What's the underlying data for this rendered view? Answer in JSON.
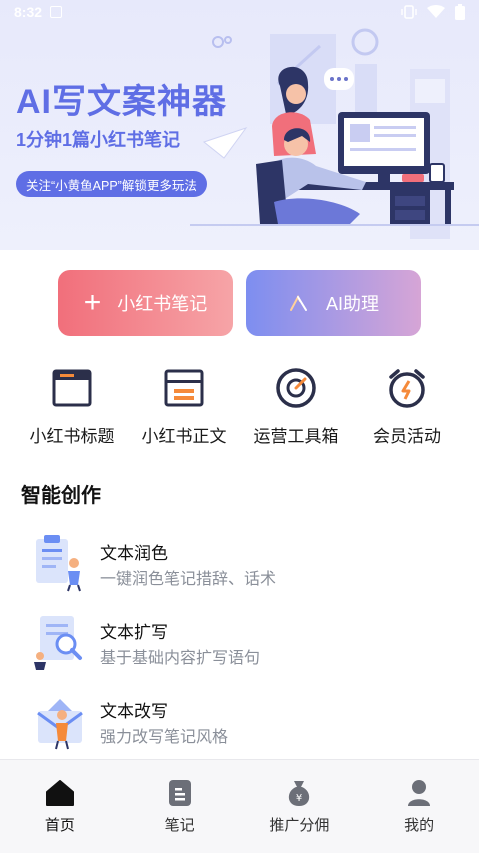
{
  "status_bar": {
    "time": "8:32"
  },
  "banner": {
    "title": "AI写文案神器",
    "subtitle": "1分钟1篇小红书笔记",
    "pill": "关注“小黄鱼APP”解锁更多玩法",
    "accent": "#5f6ee5"
  },
  "actions": [
    {
      "label": "小红书笔记",
      "icon": "plus-icon"
    },
    {
      "label": "AI助理",
      "icon": "ai-logo-icon"
    }
  ],
  "tools": [
    {
      "label": "小红书标题",
      "icon": "window-title-icon"
    },
    {
      "label": "小红书正文",
      "icon": "window-body-icon"
    },
    {
      "label": "运营工具箱",
      "icon": "target-gauge-icon"
    },
    {
      "label": "会员活动",
      "icon": "alarm-clock-icon"
    }
  ],
  "section": {
    "title": "智能创作"
  },
  "creations": [
    {
      "name": "文本润色",
      "desc": "一键润色笔记措辞、话术",
      "icon": "clipboard-person-icon"
    },
    {
      "name": "文本扩写",
      "desc": "基于基础内容扩写语句",
      "icon": "magnifier-doc-icon"
    },
    {
      "name": "文本改写",
      "desc": "强力改写笔记风格",
      "icon": "envelope-person-icon"
    }
  ],
  "nav": [
    {
      "label": "首页",
      "icon": "home-icon"
    },
    {
      "label": "笔记",
      "icon": "note-icon"
    },
    {
      "label": "推广分佣",
      "icon": "money-bag-icon"
    },
    {
      "label": "我的",
      "icon": "user-icon"
    }
  ]
}
